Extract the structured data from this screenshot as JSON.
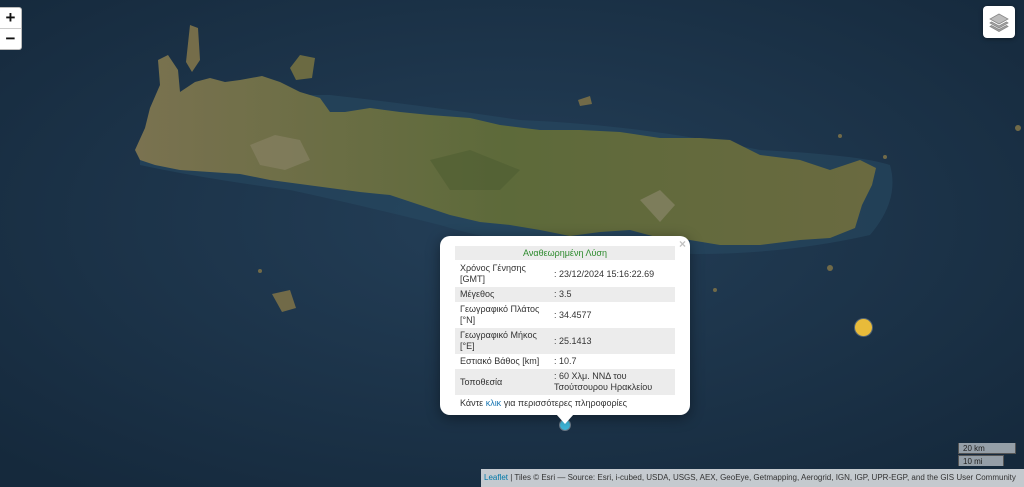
{
  "map": {
    "zoom_in": "+",
    "zoom_out": "−"
  },
  "popup": {
    "title": "Αναθεωρημένη Λύση",
    "close": "×",
    "rows": [
      {
        "label": "Χρόνος Γένησης [GMT]",
        "value": ": 23/12/2024 15:16:22.69"
      },
      {
        "label": "Μέγεθος",
        "value": ": 3.5"
      },
      {
        "label": "Γεωγραφικό Πλάτος [°N]",
        "value": ": 34.4577"
      },
      {
        "label": "Γεωγραφικό Μήκος [°E]",
        "value": ": 25.1413"
      },
      {
        "label": "Εστιακό Βάθος [km]",
        "value": ": 10.7"
      },
      {
        "label": "Τοποθεσία",
        "value": ": 60 Χλμ. ΝΝΔ του Τσούτσουρου Ηρακλείου"
      }
    ],
    "footer_prefix": "Κάντε",
    "footer_link": "κλικ",
    "footer_suffix": "για περισσότερες πληροφορίες"
  },
  "scale": {
    "km": "20 km",
    "mi": "10 mi"
  },
  "attribution": {
    "leaflet": "Leaflet",
    "text": " | Tiles © Esri — Source: Esri, i-cubed, USDA, USGS, AEX, GeoEye, Getmapping, Aerogrid, IGN, IGP, UPR-EGP, and the GIS User Community"
  },
  "colors": {
    "sea": "#1b3650",
    "land": "#6b6a42",
    "marker_recent": "#e8bb3a",
    "marker_selected": "#3fb7d9",
    "popup_title": "#2e8b2e"
  }
}
